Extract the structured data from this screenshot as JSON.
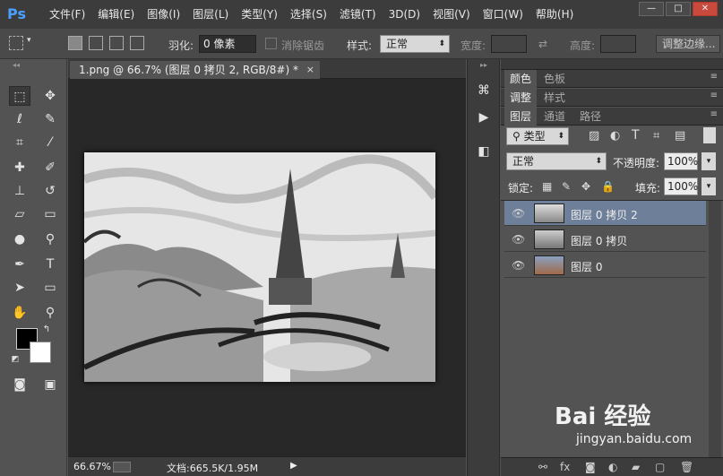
{
  "app": {
    "logo": "Ps"
  },
  "menu": [
    "文件(F)",
    "编辑(E)",
    "图像(I)",
    "图层(L)",
    "类型(Y)",
    "选择(S)",
    "滤镜(T)",
    "3D(D)",
    "视图(V)",
    "窗口(W)",
    "帮助(H)"
  ],
  "window_controls": {
    "minimize": "—",
    "maximize": "□",
    "close": "✕"
  },
  "options": {
    "feather_label": "羽化:",
    "feather_value": "0 像素",
    "antialias_label": "消除锯齿",
    "style_label": "样式:",
    "style_value": "正常",
    "width_label": "宽度:",
    "height_label": "高度:",
    "refine_button": "调整边缘..."
  },
  "document": {
    "tab_title": "1.png @ 66.7% (图层 0 拷贝 2, RGB/8#) *",
    "close": "×"
  },
  "status": {
    "zoom": "66.67%",
    "doc_info": "文档:665.5K/1.95M"
  },
  "panels": {
    "tabs_row1": [
      "颜色",
      "色板"
    ],
    "tabs_row2": [
      "调整",
      "样式"
    ],
    "tabs_row3": [
      "图层",
      "通道",
      "路径"
    ],
    "filter_kind": "类型",
    "blend_mode": "正常",
    "opacity_label": "不透明度:",
    "opacity_value": "100%",
    "lock_label": "锁定:",
    "fill_label": "填充:",
    "fill_value": "100%",
    "layers": [
      {
        "name": "图层 0 拷贝 2",
        "selected": true
      },
      {
        "name": "图层 0 拷贝",
        "selected": false
      },
      {
        "name": "图层 0",
        "selected": false
      }
    ]
  },
  "watermark": {
    "brand": "Bai 经验",
    "url": "jingyan.baidu.com"
  },
  "colors": {
    "selected_layer": "#6d7f99",
    "bg": "#535353",
    "canvas_bg": "#282828"
  }
}
